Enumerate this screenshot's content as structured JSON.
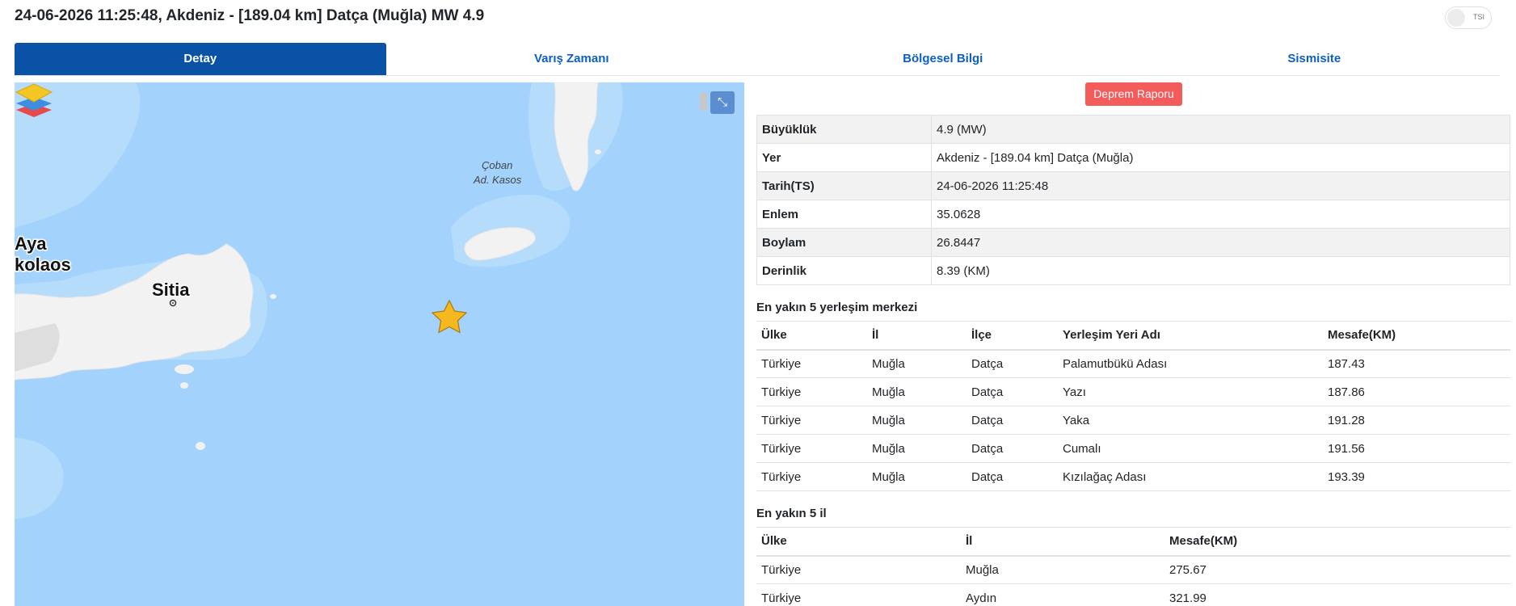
{
  "header": {
    "title": "24-06-2026 11:25:48, Akdeniz - [189.04 km] Datça (Muğla) MW 4.9",
    "toggle_label": "TSI"
  },
  "tabs": [
    {
      "label": "Detay",
      "active": true
    },
    {
      "label": "Varış Zamanı",
      "active": false
    },
    {
      "label": "Bölgesel Bilgi",
      "active": false
    },
    {
      "label": "Sismisite",
      "active": false
    }
  ],
  "map": {
    "labels": {
      "sitia": "Sitia",
      "aya": "Aya",
      "nikolaos": "kolaos",
      "coban": "Çoban",
      "kasos": "Ad. Kasos"
    },
    "ctrl_icon": "collapse-icon",
    "layers_icon": "layers-icon",
    "epicenter_icon": "star-icon",
    "colors": {
      "sea": "#a3d3fc",
      "land": "#f2f2f2",
      "star": "#f5b81f"
    }
  },
  "report_button": "Deprem Raporu",
  "details": [
    {
      "key": "Büyüklük",
      "value": "4.9 (MW)"
    },
    {
      "key": "Yer",
      "value": "Akdeniz - [189.04 km] Datça (Muğla)"
    },
    {
      "key": "Tarih(TS)",
      "value": "24-06-2026 11:25:48"
    },
    {
      "key": "Enlem",
      "value": "35.0628"
    },
    {
      "key": "Boylam",
      "value": "26.8447"
    },
    {
      "key": "Derinlik",
      "value": "8.39 (KM)"
    }
  ],
  "settlements": {
    "title": "En yakın 5 yerleşim merkezi",
    "headers": [
      "Ülke",
      "İl",
      "İlçe",
      "Yerleşim Yeri Adı",
      "Mesafe(KM)"
    ],
    "rows": [
      [
        "Türkiye",
        "Muğla",
        "Datça",
        "Palamutbükü Adası",
        "187.43"
      ],
      [
        "Türkiye",
        "Muğla",
        "Datça",
        "Yazı",
        "187.86"
      ],
      [
        "Türkiye",
        "Muğla",
        "Datça",
        "Yaka",
        "191.28"
      ],
      [
        "Türkiye",
        "Muğla",
        "Datça",
        "Cumalı",
        "191.56"
      ],
      [
        "Türkiye",
        "Muğla",
        "Datça",
        "Kızılağaç Adası",
        "193.39"
      ]
    ]
  },
  "provinces": {
    "title": "En yakın 5 il",
    "headers": [
      "Ülke",
      "İl",
      "Mesafe(KM)"
    ],
    "rows": [
      [
        "Türkiye",
        "Muğla",
        "275.67"
      ],
      [
        "Türkiye",
        "Aydın",
        "321.99"
      ]
    ]
  }
}
